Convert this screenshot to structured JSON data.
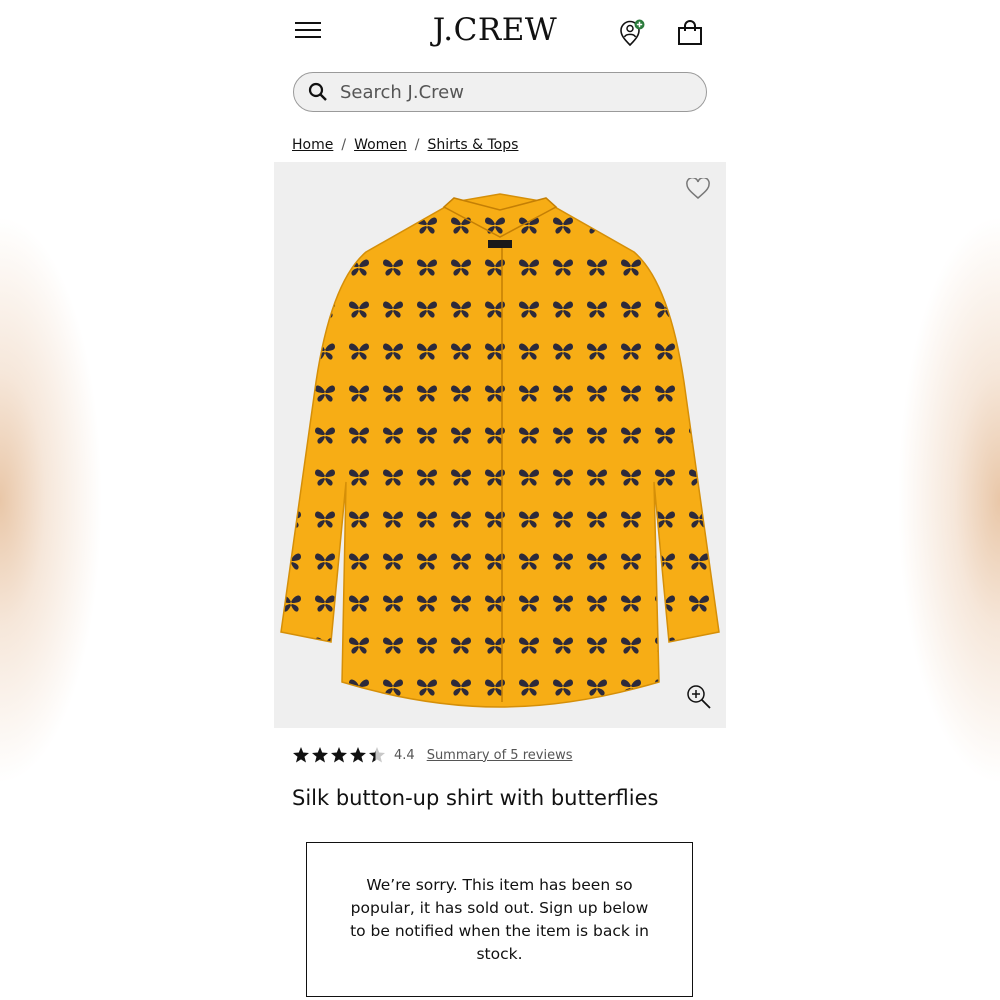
{
  "header": {
    "logo": "J.CREW",
    "menu_icon": "hamburger-menu-icon",
    "account_icon": "account-pin-icon",
    "bag_icon": "shopping-bag-icon",
    "account_badge_color": "#2a7a3b"
  },
  "search": {
    "placeholder": "Search J.Crew",
    "value": ""
  },
  "breadcrumb": [
    {
      "label": "Home"
    },
    {
      "label": "Women"
    },
    {
      "label": "Shirts & Tops"
    }
  ],
  "product": {
    "image_desc_icon": "product-image",
    "shirt_color": "#f7ad15",
    "rating": "4.4",
    "rating_value": 4.4,
    "reviews_link": "Summary of 5 reviews",
    "title": "Silk button-up shirt with butterflies",
    "soldout_message": "We’re sorry. This item has been so popular, it has sold out. Sign up below to be notified when the item is back in stock."
  }
}
